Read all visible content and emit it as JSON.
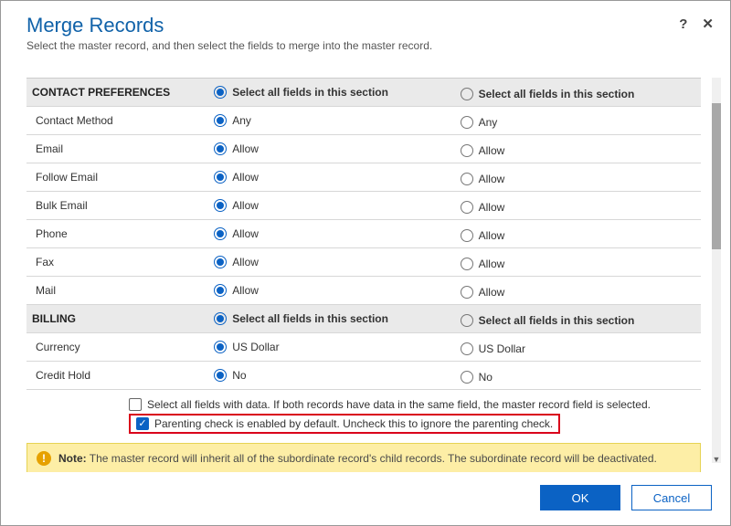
{
  "header": {
    "title": "Merge Records",
    "subtitle": "Select the master record, and then select the fields to merge into the master record.",
    "help_tooltip": "?",
    "close_tooltip": "✕"
  },
  "section_select_all_label": "Select all fields in this section",
  "sections": [
    {
      "name": "CONTACT PREFERENCES",
      "rows": [
        {
          "label": "Contact Method",
          "master": "Any",
          "sub": "Any"
        },
        {
          "label": "Email",
          "master": "Allow",
          "sub": "Allow"
        },
        {
          "label": "Follow Email",
          "master": "Allow",
          "sub": "Allow"
        },
        {
          "label": "Bulk Email",
          "master": "Allow",
          "sub": "Allow"
        },
        {
          "label": "Phone",
          "master": "Allow",
          "sub": "Allow"
        },
        {
          "label": "Fax",
          "master": "Allow",
          "sub": "Allow"
        },
        {
          "label": "Mail",
          "master": "Allow",
          "sub": "Allow"
        }
      ]
    },
    {
      "name": "BILLING",
      "rows": [
        {
          "label": "Currency",
          "master": "US Dollar",
          "sub": "US Dollar"
        },
        {
          "label": "Credit Hold",
          "master": "No",
          "sub": "No"
        }
      ]
    }
  ],
  "checks": {
    "select_all_with_data": {
      "checked": false,
      "label": "Select all fields with data. If both records have data in the same field, the master record field is selected."
    },
    "parenting_check": {
      "checked": true,
      "label": "Parenting check is enabled by default. Uncheck this to ignore the parenting check."
    }
  },
  "note": {
    "prefix": "Note:",
    "text": "The master record will inherit all of the subordinate record's child records. The subordinate record will be deactivated."
  },
  "footer": {
    "ok": "OK",
    "cancel": "Cancel"
  }
}
